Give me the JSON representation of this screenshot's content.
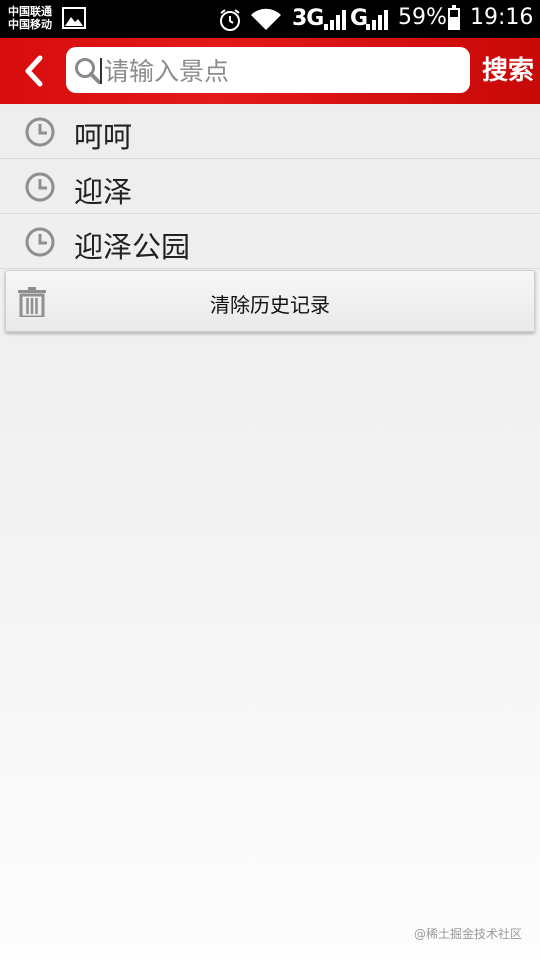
{
  "status_bar": {
    "carrier_1": "中国联通",
    "carrier_2": "中国移动",
    "network_1": "3G",
    "network_2": "G",
    "battery": "59%",
    "battery_level": 0.59,
    "time": "19:16"
  },
  "header": {
    "search_placeholder": "请输入景点",
    "search_value": "",
    "search_button": "搜索",
    "accent_color": "#e01515"
  },
  "history": {
    "items": [
      {
        "label": "呵呵"
      },
      {
        "label": "迎泽"
      },
      {
        "label": "迎泽公园"
      }
    ],
    "clear_label": "清除历史记录"
  },
  "watermark": "@稀土掘金技术社区",
  "icons": [
    "back-arrow-icon",
    "search-icon",
    "clock-icon",
    "trash-icon",
    "alarm-icon",
    "wifi-icon",
    "signal-icon",
    "battery-icon",
    "gallery-icon"
  ]
}
